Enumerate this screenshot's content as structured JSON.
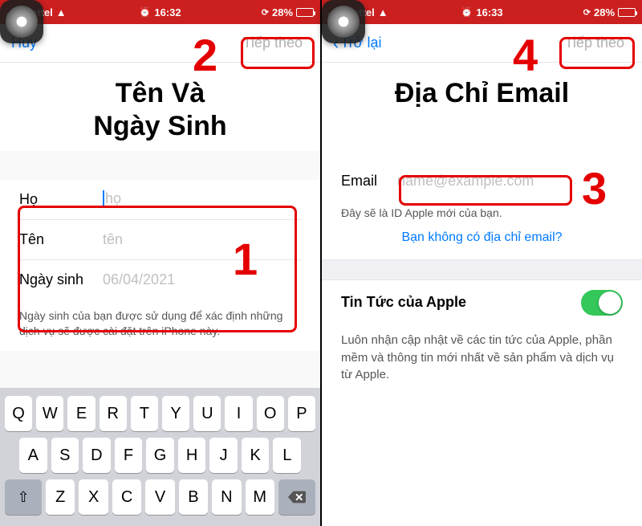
{
  "status": {
    "carrier": "Viettel",
    "time_left": "16:32",
    "time_right": "16:33",
    "battery": "28%"
  },
  "left": {
    "nav": {
      "cancel": "Hủy",
      "next": "Tiếp theo"
    },
    "title_line1": "Tên Và",
    "title_line2": "Ngày Sinh",
    "rows": {
      "lastname_label": "Họ",
      "lastname_ph": "họ",
      "firstname_label": "Tên",
      "firstname_ph": "tên",
      "birth_label": "Ngày sinh",
      "birth_val": "06/04/2021"
    },
    "helper": "Ngày sinh của bạn được sử dụng để xác định những dịch vụ sẽ được cài đặt trên iPhone này.",
    "kbd": {
      "r1": [
        "Q",
        "W",
        "E",
        "R",
        "T",
        "Y",
        "U",
        "I",
        "O",
        "P"
      ],
      "r2": [
        "A",
        "S",
        "D",
        "F",
        "G",
        "H",
        "J",
        "K",
        "L"
      ],
      "r3": [
        "Z",
        "X",
        "C",
        "V",
        "B",
        "N",
        "M"
      ]
    },
    "anno": {
      "n1": "1",
      "n2": "2"
    }
  },
  "right": {
    "nav": {
      "back": "Trở lại",
      "next": "Tiếp theo"
    },
    "title": "Địa Chỉ Email",
    "email_label": "Email",
    "email_ph": "name@example.com",
    "id_note": "Đây sẽ là ID Apple mới của bạn.",
    "no_email_link": "Bạn không có địa chỉ email?",
    "news_title": "Tin Tức của Apple",
    "news_desc": "Luôn nhận cập nhật về các tin tức của Apple, phần mềm và thông tin mới nhất về sản phẩm và dịch vụ từ Apple.",
    "anno": {
      "n3": "3",
      "n4": "4"
    }
  }
}
